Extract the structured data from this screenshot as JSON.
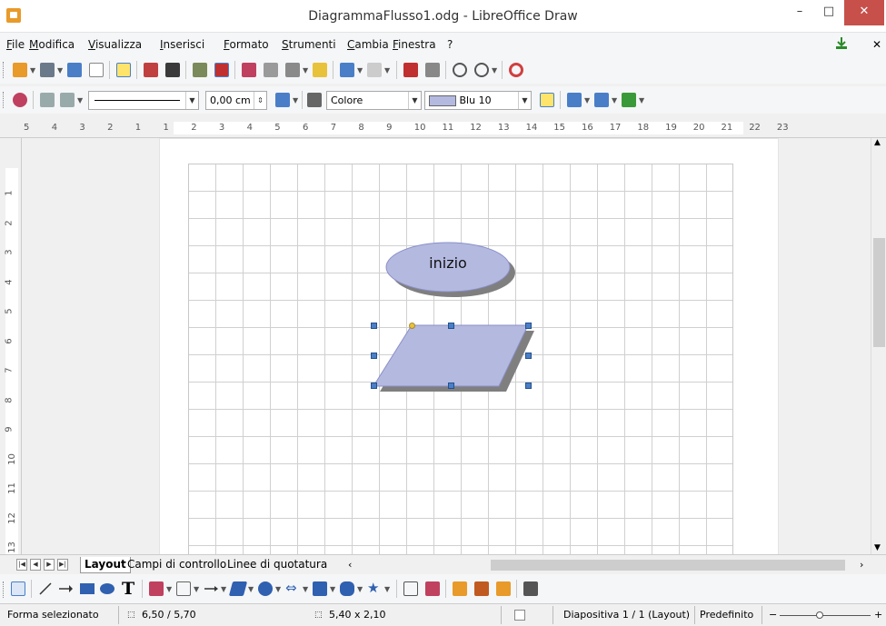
{
  "window": {
    "title": "DiagrammaFlusso1.odg - LibreOffice Draw",
    "minimize": "–",
    "maximize": "□",
    "close": "✕"
  },
  "menu": {
    "items": [
      "File",
      "Modifica",
      "Visualizza",
      "Inserisci",
      "Formato",
      "Strumenti",
      "Cambia",
      "Finestra",
      "?"
    ],
    "close_doc": "✕"
  },
  "line_format": {
    "line_width": "0,00 cm",
    "area_style": "Colore",
    "area_color_name": "Blu 10",
    "area_color_hex": "#b4b9e0"
  },
  "rulers": {
    "horizontal": [
      "5",
      "4",
      "3",
      "2",
      "1",
      "1",
      "2",
      "3",
      "4",
      "5",
      "6",
      "7",
      "8",
      "9",
      "10",
      "11",
      "12",
      "13",
      "14",
      "15",
      "16",
      "17",
      "18",
      "19",
      "20",
      "21",
      "22",
      "23"
    ],
    "vertical": [
      "1",
      "2",
      "3",
      "4",
      "5",
      "6",
      "7",
      "8",
      "9",
      "10",
      "11",
      "12",
      "13"
    ]
  },
  "canvas": {
    "ellipse_label": "inizio",
    "shape_fill": "#b4b9e0",
    "shadow_color": "#7f7f7f",
    "handle_color": "#4a7fc8",
    "rotation_handle_color": "#e8c23a"
  },
  "tabs": {
    "items": [
      "Layout",
      "Campi di controllo",
      "Linee di quotatura"
    ],
    "active": "Layout"
  },
  "status": {
    "selection": "Forma selezionato",
    "position": "6,50 / 5,70",
    "size": "5,40 x 2,10",
    "slide": "Diapositiva 1 / 1 (Layout)",
    "master": "Predefinito"
  }
}
